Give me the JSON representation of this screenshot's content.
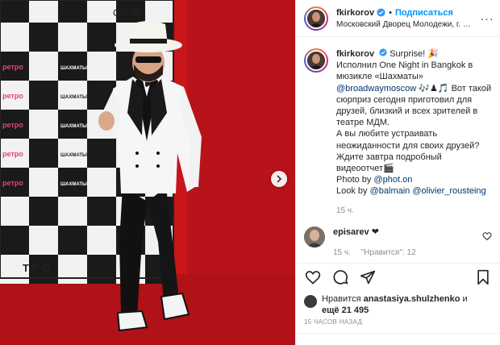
{
  "post": {
    "username": "fkirkorov",
    "dot": "•",
    "follow_label": "Подписаться",
    "location": "Московский Дворец Молодежи, г. Москва, ..."
  },
  "caption": {
    "username": "fkirkorov",
    "line1_text": "Surprise! 🎉",
    "line2": "Исполнил One Night in Bangkok в",
    "line3": "мюзикле «Шахматы»",
    "mention_broadway": "@broadwaymoscow",
    "line4_after": " 🎶♟🎵 Вот такой",
    "line5": "сюрприз сегодня приготовил для",
    "line6": "друзей, близкий и всех зрителей в",
    "line7": "театре МДМ.",
    "line8": "А вы любите устраивать",
    "line9": "неожиданности для своих друзей?",
    "line10": "Ждите завтра подробный",
    "line11": "видеоотчет🎬",
    "photo_by_label": "Photo by ",
    "mention_photon": "@phot.on",
    "look_by_label": "Look by ",
    "mention_balmain": "@balmain",
    "mention_olivier": "@olivier_rousteing",
    "time": "15 ч."
  },
  "comment": {
    "username": "episarev",
    "text": " ❤",
    "time": "15 ч.",
    "likes": "\"Нравится\": 12"
  },
  "likes": {
    "prefix": "Нравится ",
    "user": "anastasiya.shulzhenko",
    "middle": " и",
    "count": "ещё 21 495"
  },
  "post_time": "15 ЧАСОВ НАЗАД",
  "backdrop": {
    "board_labels": [
      "ШАХМАТЫ",
      "ретро"
    ],
    "top_text": "O F M",
    "bottom_text": "Т Р О"
  },
  "colors": {
    "accent": "#0095f6",
    "wall_red": "#c41419",
    "text": "#262626",
    "muted": "#8e8e8e"
  },
  "icons": [
    "verified-badge-icon",
    "more-options-icon",
    "heart-icon",
    "comment-icon",
    "share-icon",
    "bookmark-icon",
    "chevron-right-icon"
  ]
}
